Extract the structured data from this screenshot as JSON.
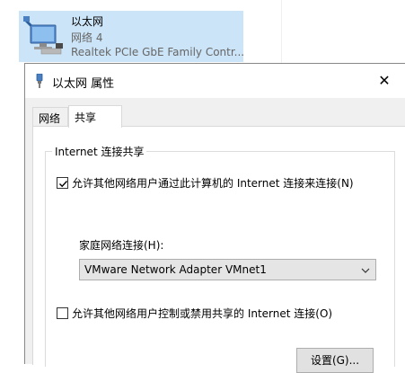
{
  "adapter": {
    "name": "以太网",
    "network": "网络 4",
    "device": "Realtek PCIe GbE Family Contr...",
    "icon": "network-adapter-icon"
  },
  "dialog": {
    "title": "以太网 属性",
    "title_icon": "network-plug-icon",
    "close_label": "✕",
    "tabs": [
      {
        "label": "网络",
        "selected": false
      },
      {
        "label": "共享",
        "selected": true
      }
    ],
    "group": {
      "title": "Internet 连接共享",
      "allow_share": {
        "label": "允许其他网络用户通过此计算机的 Internet 连接来连接(N)",
        "checked": true
      },
      "home_network_label": "家庭网络连接(H):",
      "home_network_value": "VMware Network Adapter VMnet1",
      "allow_control": {
        "label": "允许其他网络用户控制或禁用共享的 Internet 连接(O)",
        "checked": false
      },
      "settings_button": "设置(G)..."
    }
  }
}
